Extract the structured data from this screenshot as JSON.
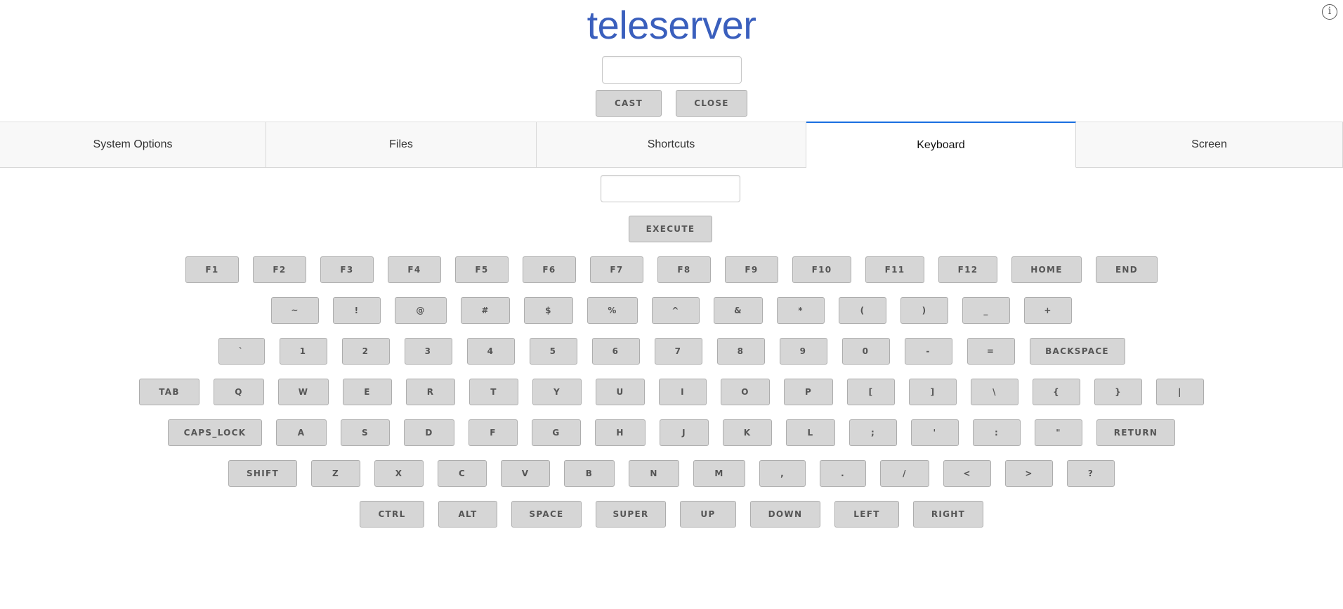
{
  "app": {
    "title": "teleserver"
  },
  "top": {
    "input_value": "",
    "cast_label": "CAST",
    "close_label": "CLOSE"
  },
  "tabs": [
    {
      "label": "System Options",
      "active": false
    },
    {
      "label": "Files",
      "active": false
    },
    {
      "label": "Shortcuts",
      "active": false
    },
    {
      "label": "Keyboard",
      "active": true
    },
    {
      "label": "Screen",
      "active": false
    }
  ],
  "keyboard": {
    "input_value": "",
    "execute_label": "EXECUTE",
    "rows": [
      [
        "F1",
        "F2",
        "F3",
        "F4",
        "F5",
        "F6",
        "F7",
        "F8",
        "F9",
        "F10",
        "F11",
        "F12",
        "HOME",
        "END"
      ],
      [
        "~",
        "!",
        "@",
        "#",
        "$",
        "%",
        "^",
        "&",
        "*",
        "(",
        ")",
        "_",
        "+"
      ],
      [
        "`",
        "1",
        "2",
        "3",
        "4",
        "5",
        "6",
        "7",
        "8",
        "9",
        "0",
        "-",
        "=",
        "BACKSPACE"
      ],
      [
        "TAB",
        "Q",
        "W",
        "E",
        "R",
        "T",
        "Y",
        "U",
        "I",
        "O",
        "P",
        "[",
        "]",
        "\\",
        "{",
        "}",
        "|"
      ],
      [
        "CAPS_LOCK",
        "A",
        "S",
        "D",
        "F",
        "G",
        "H",
        "J",
        "K",
        "L",
        ";",
        "'",
        ":",
        "\"",
        "RETURN"
      ],
      [
        "SHIFT",
        "Z",
        "X",
        "C",
        "V",
        "B",
        "N",
        "M",
        ",",
        ".",
        "/",
        "<",
        ">",
        "?"
      ],
      [
        "CTRL",
        "ALT",
        "SPACE",
        "SUPER",
        "UP",
        "DOWN",
        "LEFT",
        "RIGHT"
      ]
    ]
  },
  "icons": {
    "info": "info-icon"
  },
  "colors": {
    "title": "#3a5fbd",
    "active_tab_accent": "#1a6fe0",
    "key_bg": "#d6d6d6"
  }
}
